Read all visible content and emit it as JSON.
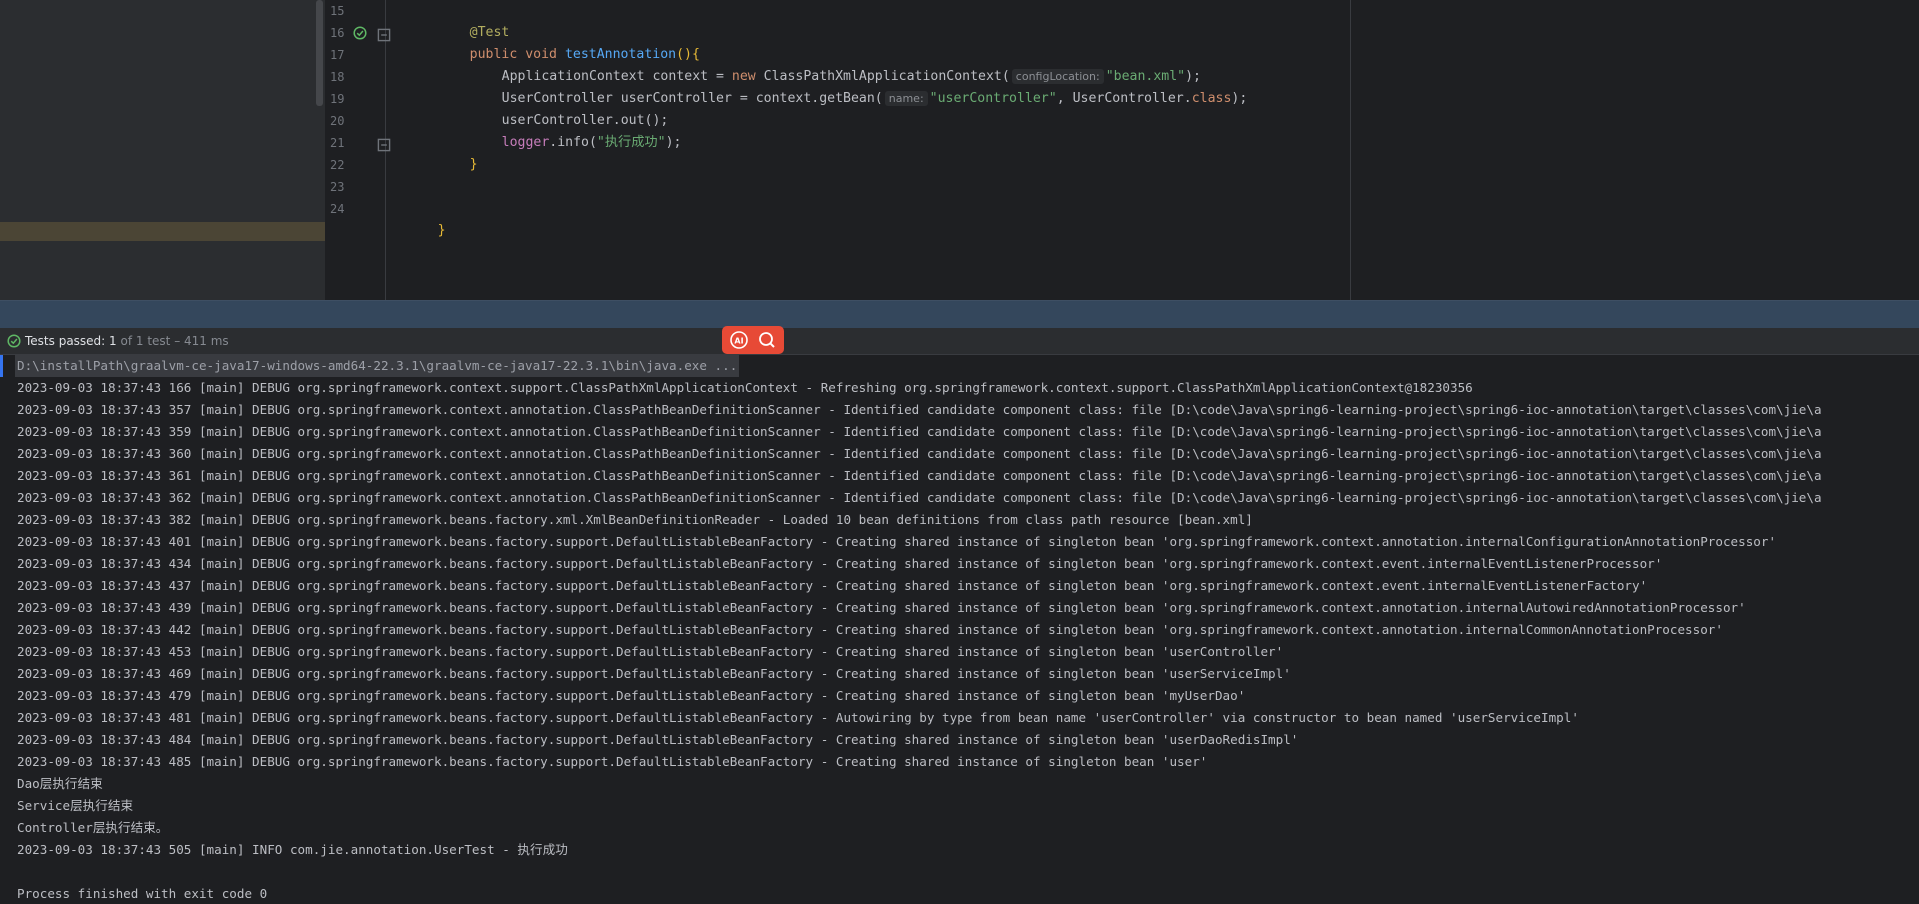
{
  "editor": {
    "lines": [
      {
        "num": "15",
        "text": "@Test"
      },
      {
        "num": "16",
        "text": "public void testAnnotation(){"
      },
      {
        "num": "17",
        "text": "ApplicationContext context = new ClassPathXmlApplicationContext( configLocation: \"bean.xml\");"
      },
      {
        "num": "18",
        "text": "UserController userController = context.getBean( name: \"userController\", UserController.class);"
      },
      {
        "num": "19",
        "text": "userController.out();"
      },
      {
        "num": "20",
        "text": "logger.info(\"执行成功\");"
      },
      {
        "num": "21",
        "text": "}"
      },
      {
        "num": "22",
        "text": ""
      },
      {
        "num": "23",
        "text": ""
      },
      {
        "num": "24",
        "text": "}"
      }
    ],
    "tokens": {
      "l15_ann": "@Test",
      "l16_kw1": "public",
      "l16_kw2": "void",
      "l16_fn": "testAnnotation",
      "l16_rest": "(){",
      "l17_a": "ApplicationContext context = ",
      "l17_kw": "new",
      "l17_b": " ClassPathXmlApplicationContext(",
      "l17_hint": "configLocation:",
      "l17_str": "\"bean.xml\"",
      "l17_end": ");",
      "l18_a": "UserController userController = context.getBean(",
      "l18_hint": "name:",
      "l18_str": "\"userController\"",
      "l18_b": ", UserController.",
      "l18_kw": "class",
      "l18_end": ");",
      "l19": "userController.out();",
      "l20_field": "logger",
      "l20_a": ".info(",
      "l20_str": "\"执行成功\"",
      "l20_end": ");",
      "l21": "}",
      "l24": "}"
    }
  },
  "status": {
    "label": "Tests passed:",
    "count": "1",
    "detail": "of 1 test – 411 ms",
    "icon": "check-circle-icon"
  },
  "floating_tools": {
    "ai_icon": "ai-assistant-icon",
    "search_icon": "search-icon",
    "ai_label": "AI"
  },
  "console": {
    "command": "D:\\installPath\\graalvm-ce-java17-windows-amd64-22.3.1\\graalvm-ce-java17-22.3.1\\bin\\java.exe ...",
    "lines": [
      "2023-09-03 18:37:43 166 [main] DEBUG org.springframework.context.support.ClassPathXmlApplicationContext - Refreshing org.springframework.context.support.ClassPathXmlApplicationContext@18230356",
      "2023-09-03 18:37:43 357 [main] DEBUG org.springframework.context.annotation.ClassPathBeanDefinitionScanner - Identified candidate component class: file [D:\\code\\Java\\spring6-learning-project\\spring6-ioc-annotation\\target\\classes\\com\\jie\\a",
      "2023-09-03 18:37:43 359 [main] DEBUG org.springframework.context.annotation.ClassPathBeanDefinitionScanner - Identified candidate component class: file [D:\\code\\Java\\spring6-learning-project\\spring6-ioc-annotation\\target\\classes\\com\\jie\\a",
      "2023-09-03 18:37:43 360 [main] DEBUG org.springframework.context.annotation.ClassPathBeanDefinitionScanner - Identified candidate component class: file [D:\\code\\Java\\spring6-learning-project\\spring6-ioc-annotation\\target\\classes\\com\\jie\\a",
      "2023-09-03 18:37:43 361 [main] DEBUG org.springframework.context.annotation.ClassPathBeanDefinitionScanner - Identified candidate component class: file [D:\\code\\Java\\spring6-learning-project\\spring6-ioc-annotation\\target\\classes\\com\\jie\\a",
      "2023-09-03 18:37:43 362 [main] DEBUG org.springframework.context.annotation.ClassPathBeanDefinitionScanner - Identified candidate component class: file [D:\\code\\Java\\spring6-learning-project\\spring6-ioc-annotation\\target\\classes\\com\\jie\\a",
      "2023-09-03 18:37:43 382 [main] DEBUG org.springframework.beans.factory.xml.XmlBeanDefinitionReader - Loaded 10 bean definitions from class path resource [bean.xml]",
      "2023-09-03 18:37:43 401 [main] DEBUG org.springframework.beans.factory.support.DefaultListableBeanFactory - Creating shared instance of singleton bean 'org.springframework.context.annotation.internalConfigurationAnnotationProcessor'",
      "2023-09-03 18:37:43 434 [main] DEBUG org.springframework.beans.factory.support.DefaultListableBeanFactory - Creating shared instance of singleton bean 'org.springframework.context.event.internalEventListenerProcessor'",
      "2023-09-03 18:37:43 437 [main] DEBUG org.springframework.beans.factory.support.DefaultListableBeanFactory - Creating shared instance of singleton bean 'org.springframework.context.event.internalEventListenerFactory'",
      "2023-09-03 18:37:43 439 [main] DEBUG org.springframework.beans.factory.support.DefaultListableBeanFactory - Creating shared instance of singleton bean 'org.springframework.context.annotation.internalAutowiredAnnotationProcessor'",
      "2023-09-03 18:37:43 442 [main] DEBUG org.springframework.beans.factory.support.DefaultListableBeanFactory - Creating shared instance of singleton bean 'org.springframework.context.annotation.internalCommonAnnotationProcessor'",
      "2023-09-03 18:37:43 453 [main] DEBUG org.springframework.beans.factory.support.DefaultListableBeanFactory - Creating shared instance of singleton bean 'userController'",
      "2023-09-03 18:37:43 469 [main] DEBUG org.springframework.beans.factory.support.DefaultListableBeanFactory - Creating shared instance of singleton bean 'userServiceImpl'",
      "2023-09-03 18:37:43 479 [main] DEBUG org.springframework.beans.factory.support.DefaultListableBeanFactory - Creating shared instance of singleton bean 'myUserDao'",
      "2023-09-03 18:37:43 481 [main] DEBUG org.springframework.beans.factory.support.DefaultListableBeanFactory - Autowiring by type from bean name 'userController' via constructor to bean named 'userServiceImpl'",
      "2023-09-03 18:37:43 484 [main] DEBUG org.springframework.beans.factory.support.DefaultListableBeanFactory - Creating shared instance of singleton bean 'userDaoRedisImpl'",
      "2023-09-03 18:37:43 485 [main] DEBUG org.springframework.beans.factory.support.DefaultListableBeanFactory - Creating shared instance of singleton bean 'user'",
      "Dao层执行结束",
      "Service层执行结束",
      "Controller层执行结束。",
      "2023-09-03 18:37:43 505 [main] INFO com.jie.annotation.UserTest - 执行成功",
      "",
      "Process finished with exit code 0"
    ]
  },
  "colors": {
    "editor_bg": "#1e1f22",
    "panel_bg": "#2b2d30",
    "keyword": "#cf8e6d",
    "string": "#6aab73",
    "annotation": "#b3ae60",
    "function": "#56a8f5",
    "pass_green": "#5fb865",
    "float_toolbar": "#e74a36"
  }
}
